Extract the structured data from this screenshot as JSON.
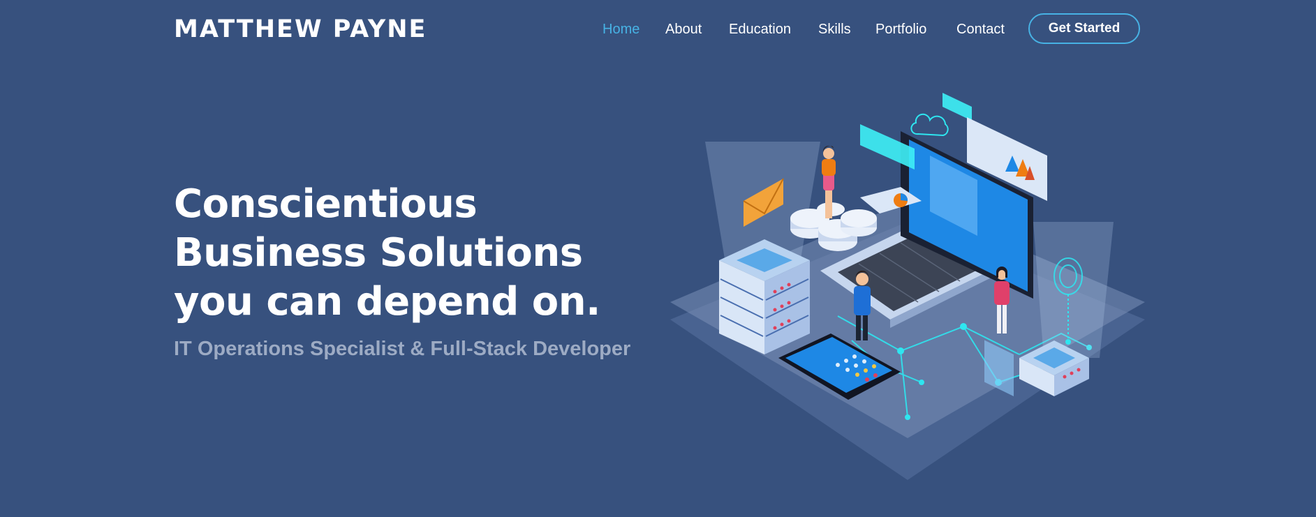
{
  "header": {
    "logo": "MATTHEW PAYNE",
    "nav": [
      {
        "label": "Home",
        "active": true
      },
      {
        "label": "About",
        "active": false
      },
      {
        "label": "Education",
        "active": false
      },
      {
        "label": "Skills",
        "active": false
      },
      {
        "label": "Portfolio",
        "active": false
      },
      {
        "label": "Contact",
        "active": false
      }
    ],
    "cta_label": "Get Started"
  },
  "hero": {
    "title": "Conscientious Business Solutions you can depend on.",
    "subtitle": "IT Operations Specialist & Full-Stack Developer",
    "illustration_icon": "isometric-it-infrastructure-illustration"
  },
  "colors": {
    "background": "#37517e",
    "accent": "#47b2e4",
    "subtitle": "#9dabc4",
    "cyan": "#2ee6f0"
  }
}
